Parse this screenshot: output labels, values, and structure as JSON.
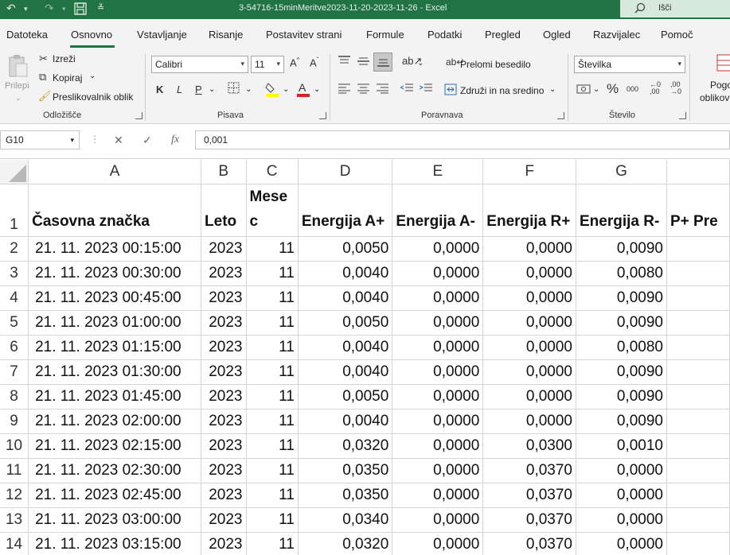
{
  "titlebar": {
    "title": "3-54716-15minMeritve2023-11-20-2023-11-26  -  Excel",
    "search_placeholder": "Išči",
    "accent": "#217346"
  },
  "tabs": [
    "Datoteka",
    "Osnovno",
    "Vstavljanje",
    "Risanje",
    "Postavitev strani",
    "Formule",
    "Podatki",
    "Pregled",
    "Ogled",
    "Razvijalec",
    "Pomoč"
  ],
  "active_tab": "Osnovno",
  "ribbon": {
    "clipboard": {
      "paste": "Prilepi",
      "cut": "Izreži",
      "copy": "Kopiraj",
      "format_painter": "Preslikovalnik oblik",
      "label": "Odložišče"
    },
    "font": {
      "name": "Calibri",
      "size": "11",
      "bold": "K",
      "italic": "L",
      "underline": "P",
      "label": "Pisava"
    },
    "alignment": {
      "wrap": "Prelomi besedilo",
      "merge": "Združi in na sredino",
      "label": "Poravnava"
    },
    "number": {
      "format": "Številka",
      "label": "Število"
    },
    "styles": {
      "cond_line1": "Pogo",
      "cond_line2": "oblikov"
    }
  },
  "formula_bar": {
    "cell_ref": "G10",
    "value": "0,001"
  },
  "columns": [
    "A",
    "B",
    "C",
    "D",
    "E",
    "F",
    "G",
    ""
  ],
  "headers": [
    "Časovna značka",
    "Leto",
    "Mesec",
    "Energija A+",
    "Energija A-",
    "Energija R+",
    "Energija R-",
    "P+ Pre"
  ],
  "rows": [
    {
      "n": "2",
      "cells": [
        "21. 11. 2023 00:15:00",
        "2023",
        "11",
        "0,0050",
        "0,0000",
        "0,0000",
        "0,0090"
      ]
    },
    {
      "n": "3",
      "cells": [
        "21. 11. 2023 00:30:00",
        "2023",
        "11",
        "0,0040",
        "0,0000",
        "0,0000",
        "0,0080"
      ]
    },
    {
      "n": "4",
      "cells": [
        "21. 11. 2023 00:45:00",
        "2023",
        "11",
        "0,0040",
        "0,0000",
        "0,0000",
        "0,0090"
      ]
    },
    {
      "n": "5",
      "cells": [
        "21. 11. 2023 01:00:00",
        "2023",
        "11",
        "0,0050",
        "0,0000",
        "0,0000",
        "0,0090"
      ]
    },
    {
      "n": "6",
      "cells": [
        "21. 11. 2023 01:15:00",
        "2023",
        "11",
        "0,0040",
        "0,0000",
        "0,0000",
        "0,0080"
      ]
    },
    {
      "n": "7",
      "cells": [
        "21. 11. 2023 01:30:00",
        "2023",
        "11",
        "0,0040",
        "0,0000",
        "0,0000",
        "0,0090"
      ]
    },
    {
      "n": "8",
      "cells": [
        "21. 11. 2023 01:45:00",
        "2023",
        "11",
        "0,0050",
        "0,0000",
        "0,0000",
        "0,0090"
      ]
    },
    {
      "n": "9",
      "cells": [
        "21. 11. 2023 02:00:00",
        "2023",
        "11",
        "0,0040",
        "0,0000",
        "0,0000",
        "0,0090"
      ]
    },
    {
      "n": "10",
      "cells": [
        "21. 11. 2023 02:15:00",
        "2023",
        "11",
        "0,0320",
        "0,0000",
        "0,0300",
        "0,0010"
      ]
    },
    {
      "n": "11",
      "cells": [
        "21. 11. 2023 02:30:00",
        "2023",
        "11",
        "0,0350",
        "0,0000",
        "0,0370",
        "0,0000"
      ]
    },
    {
      "n": "12",
      "cells": [
        "21. 11. 2023 02:45:00",
        "2023",
        "11",
        "0,0350",
        "0,0000",
        "0,0370",
        "0,0000"
      ]
    },
    {
      "n": "13",
      "cells": [
        "21. 11. 2023 03:00:00",
        "2023",
        "11",
        "0,0340",
        "0,0000",
        "0,0370",
        "0,0000"
      ]
    },
    {
      "n": "14",
      "cells": [
        "21. 11. 2023 03:15:00",
        "2023",
        "11",
        "0,0320",
        "0,0000",
        "0,0370",
        "0,0000"
      ]
    }
  ]
}
